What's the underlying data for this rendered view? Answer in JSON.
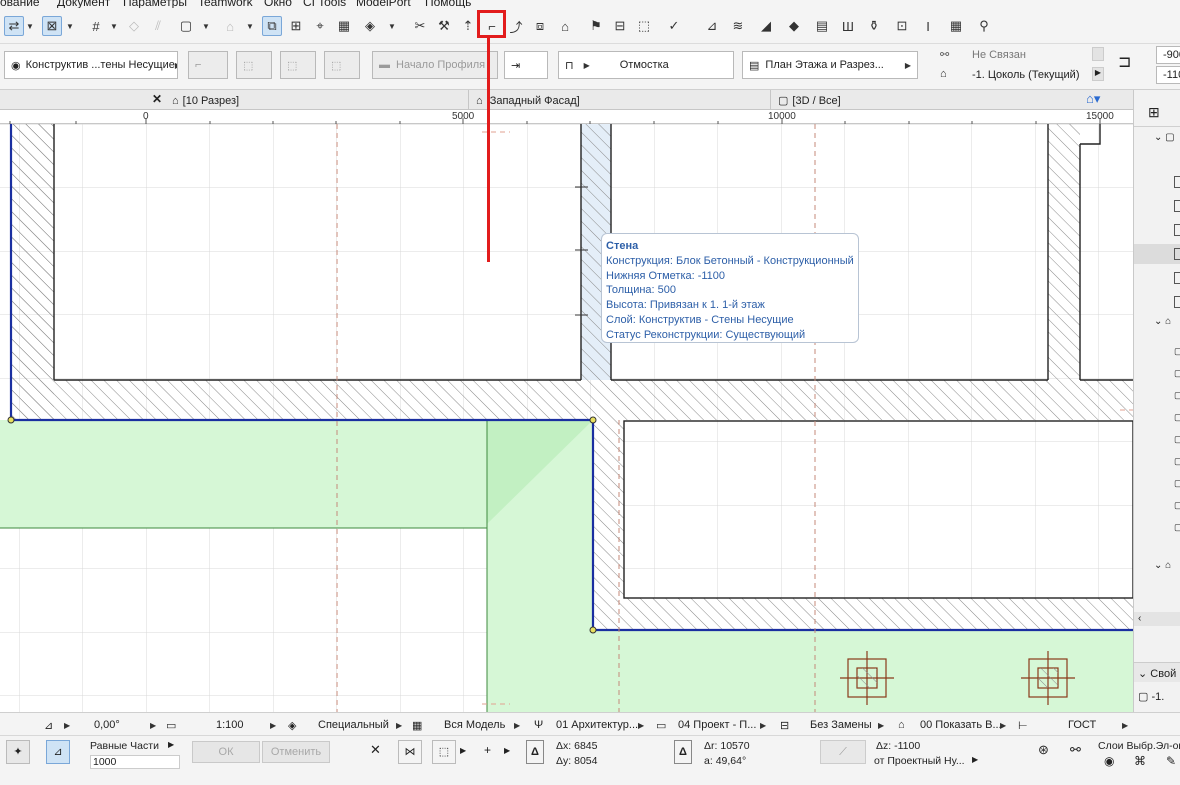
{
  "menu": {
    "items": [
      "ование",
      "Документ",
      "Параметры",
      "Teamwork",
      "Окно",
      "CI Tools",
      "ModelPort",
      "Помощь"
    ]
  },
  "toolbar_main": {
    "icons": [
      "wall-tool-icon",
      "grid-icon",
      "snap-guide-icon",
      "cursor-snap-icon",
      "selection-icon",
      "zoom-icon",
      "bim-icon",
      "trim-icon",
      "adjust-icon",
      "elevation-icon",
      "offset-icon",
      "arc-icon",
      "fillet-icon",
      "house-icon",
      "flag-icon",
      "layer-icon",
      "marquee-icon",
      "check-icon",
      "profile-icon",
      "slab-icon",
      "roof-icon",
      "mesh-icon",
      "stair-icon",
      "railing-icon",
      "beam-icon",
      "column-icon",
      "curtain-wall-icon",
      "morph-icon"
    ]
  },
  "infobox": {
    "layer_label": "Конструктив ...тены Несущие",
    "profile_start": "Начало Профиля",
    "relative_ref": "Отмостка",
    "view_mode": "План Этажа и Разрез...",
    "link_status": "Не Связан",
    "story": "-1. Цоколь (Текущий)",
    "value1": "-900",
    "value2": "-110"
  },
  "tabs": [
    {
      "label": "[10 Разрез]"
    },
    {
      "label": "[Западный Фасад]"
    },
    {
      "label": "[3D / Все]"
    }
  ],
  "ruler": {
    "marks": [
      "0",
      "5000",
      "10000",
      "15000"
    ]
  },
  "tooltip": {
    "title": "Стена",
    "lines": [
      "Конструкция: Блок Бетонный - Конструкционный",
      "Нижняя Отметка: -1100",
      "Толщина: 500",
      "Высота: Привязан к 1. 1-й этаж",
      "Слой: Конструктив - Стены Несущие",
      "Статус Реконструкции: Существующий"
    ]
  },
  "side_panel": {
    "label1": "Свой",
    "label2": "-1."
  },
  "status_bar": {
    "angle": "0,00°",
    "scale": "1:100",
    "layer_combo": "Специальный",
    "model_view": "Вся Модель",
    "pen_set": "01 Архитектур...",
    "mvo": "04 Проект - П...",
    "override": "Без Замены",
    "renovation": "00 Показать В...",
    "dimension": "ГОСТ"
  },
  "coord_bar": {
    "mode_label": "Равные Части",
    "mode_value": "1000",
    "ok": "ОК",
    "cancel": "Отменить",
    "dx_label": "Δx:",
    "dx": "6845",
    "dy_label": "Δy:",
    "dy": "8054",
    "dr_label": "Δr:",
    "dr": "10570",
    "a_label": "a:",
    "angle": "49,64°",
    "dz_label": "Δz:",
    "dz": "-1100",
    "ref_plane": "от Проектный Ну...",
    "layers_label": "Слои Выбр.Эл-ов"
  }
}
